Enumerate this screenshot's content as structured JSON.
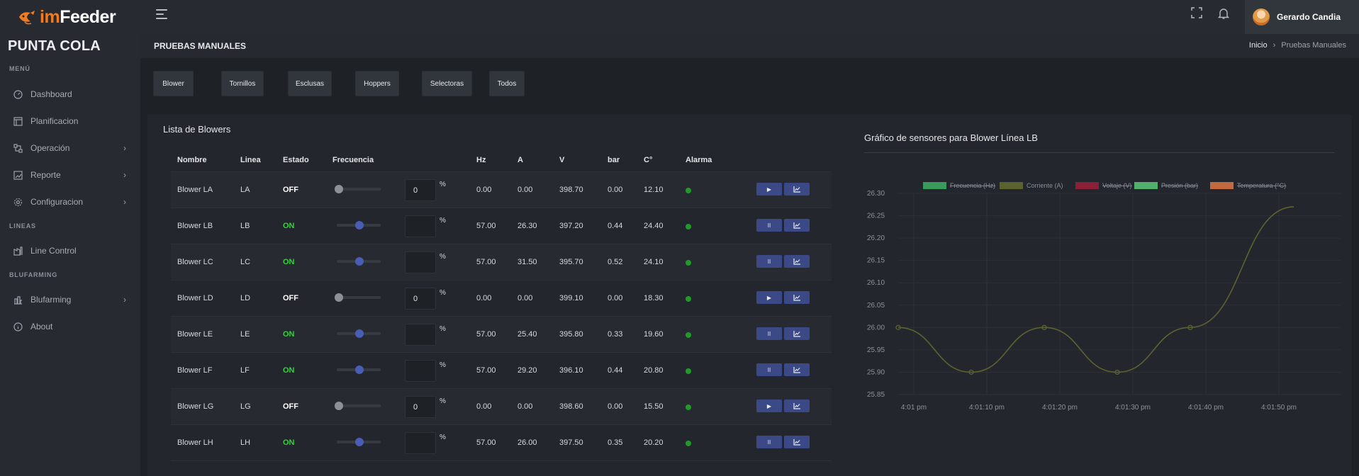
{
  "brand": {
    "prefix": "im",
    "name": "Feeder"
  },
  "user": {
    "name": "Gerardo Candia"
  },
  "sidebar": {
    "farm": "PUNTA COLA",
    "sections": {
      "menu": "MENÚ",
      "lineas": "LINEAS",
      "blufarming": "BLUFARMING"
    },
    "items": [
      {
        "label": "Dashboard",
        "icon": "dashboard-icon"
      },
      {
        "label": "Planificacion",
        "icon": "calendar-icon"
      },
      {
        "label": "Operación",
        "icon": "operation-icon",
        "chevron": "›"
      },
      {
        "label": "Reporte",
        "icon": "report-icon",
        "chevron": "›"
      },
      {
        "label": "Configuracion",
        "icon": "gear-icon",
        "chevron": "›"
      },
      {
        "label": "Line Control",
        "icon": "line-control-icon"
      },
      {
        "label": "Blufarming",
        "icon": "blufarming-icon",
        "chevron": "›"
      },
      {
        "label": "About",
        "icon": "info-icon"
      }
    ]
  },
  "header": {
    "title": "PRUEBAS MANUALES",
    "breadcrumb": {
      "home": "Inicio",
      "sep": "›",
      "current": "Pruebas Manuales"
    }
  },
  "tabs": [
    "Blower",
    "Tornillos",
    "Esclusas",
    "Hoppers",
    "Selectoras",
    "Todos"
  ],
  "list": {
    "title": "Lista de Blowers",
    "headers": [
      "Nombre",
      "Linea",
      "Estado",
      "Frecuencia",
      "Hz",
      "A",
      "V",
      "bar",
      "C°",
      "Alarma"
    ],
    "percent_symbol": "%",
    "rows": [
      {
        "nombre": "Blower LA",
        "linea": "LA",
        "estado": "OFF",
        "freq": "0",
        "slider": 0,
        "hz": "0.00",
        "a": "0.00",
        "v": "398.70",
        "bar": "0.00",
        "c": "12.10",
        "action": "▶"
      },
      {
        "nombre": "Blower LB",
        "linea": "LB",
        "estado": "ON",
        "freq": "",
        "slider": 0.57,
        "hz": "57.00",
        "a": "26.30",
        "v": "397.20",
        "bar": "0.44",
        "c": "24.40",
        "action": "II"
      },
      {
        "nombre": "Blower LC",
        "linea": "LC",
        "estado": "ON",
        "freq": "",
        "slider": 0.57,
        "hz": "57.00",
        "a": "31.50",
        "v": "395.70",
        "bar": "0.52",
        "c": "24.10",
        "action": "II"
      },
      {
        "nombre": "Blower LD",
        "linea": "LD",
        "estado": "OFF",
        "freq": "0",
        "slider": 0,
        "hz": "0.00",
        "a": "0.00",
        "v": "399.10",
        "bar": "0.00",
        "c": "18.30",
        "action": "▶"
      },
      {
        "nombre": "Blower LE",
        "linea": "LE",
        "estado": "ON",
        "freq": "",
        "slider": 0.57,
        "hz": "57.00",
        "a": "25.40",
        "v": "395.80",
        "bar": "0.33",
        "c": "19.60",
        "action": "II"
      },
      {
        "nombre": "Blower LF",
        "linea": "LF",
        "estado": "ON",
        "freq": "",
        "slider": 0.57,
        "hz": "57.00",
        "a": "29.20",
        "v": "396.10",
        "bar": "0.44",
        "c": "20.80",
        "action": "II"
      },
      {
        "nombre": "Blower LG",
        "linea": "LG",
        "estado": "OFF",
        "freq": "0",
        "slider": 0,
        "hz": "0.00",
        "a": "0.00",
        "v": "398.60",
        "bar": "0.00",
        "c": "15.50",
        "action": "▶"
      },
      {
        "nombre": "Blower LH",
        "linea": "LH",
        "estado": "ON",
        "freq": "",
        "slider": 0.57,
        "hz": "57.00",
        "a": "26.00",
        "v": "397.50",
        "bar": "0.35",
        "c": "20.20",
        "action": "II"
      }
    ]
  },
  "chart_data": {
    "type": "line",
    "title": "Gráfico de sensores para Blower Línea LB",
    "legend_position": "top-center",
    "legend": [
      {
        "name": "Frecuencia (Hz)",
        "color": "#3a9a5b",
        "struck": true
      },
      {
        "name": "Corriente (A)",
        "color": "#5a6330",
        "struck": false
      },
      {
        "name": "Voltaje (V)",
        "color": "#8a2037",
        "struck": true
      },
      {
        "name": "Presión (bar)",
        "color": "#52b06d",
        "struck": true
      },
      {
        "name": "Temperatura (°C)",
        "color": "#c26a3d",
        "struck": true
      }
    ],
    "x": [
      "4:01 pm",
      "4:01:10 pm",
      "4:01:20 pm",
      "4:01:30 pm",
      "4:01:40 pm",
      "4:01:50 pm"
    ],
    "yticks": [
      "26.30",
      "26.25",
      "26.20",
      "26.15",
      "26.10",
      "26.05",
      "26.00",
      "25.95",
      "25.90",
      "25.85"
    ],
    "ylim": [
      25.85,
      26.3
    ],
    "series": [
      {
        "name": "Corriente (A)",
        "color": "#5a6330",
        "points": [
          [
            0,
            26.0
          ],
          [
            1,
            25.9
          ],
          [
            2,
            26.0
          ],
          [
            3,
            25.9
          ],
          [
            4,
            26.0
          ],
          [
            5.42,
            26.27
          ]
        ]
      }
    ],
    "grid": true
  }
}
